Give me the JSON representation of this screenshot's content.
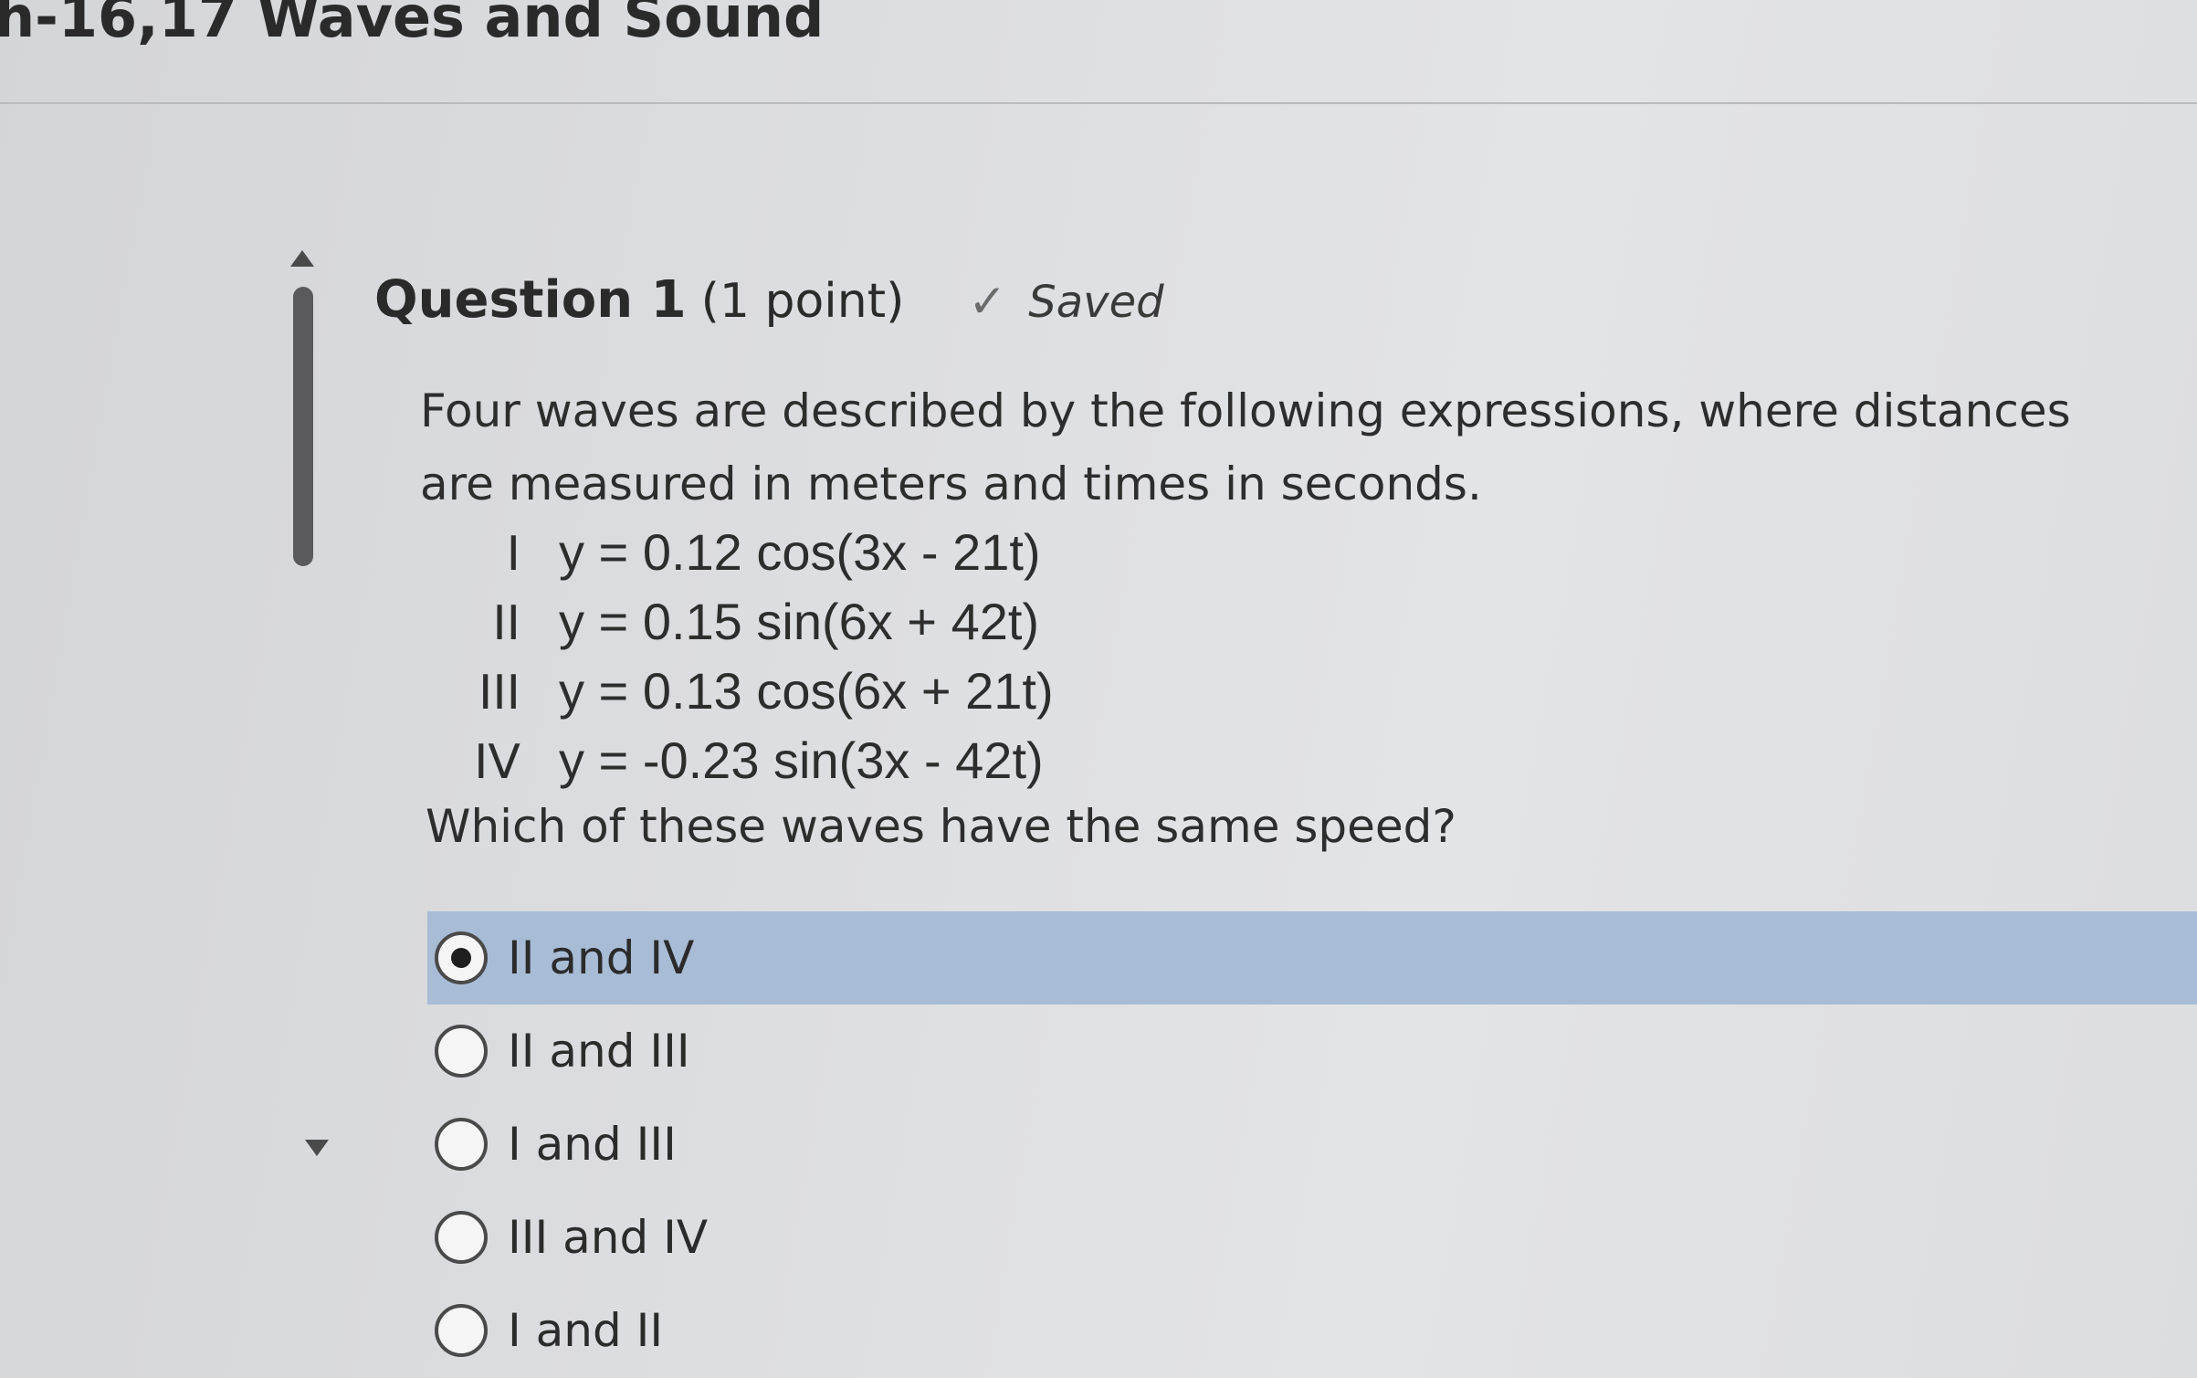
{
  "page": {
    "title": "h-16,17 Waves and Sound"
  },
  "question": {
    "label": "Question 1",
    "points": "(1 point)",
    "status": "Saved",
    "prompt": "Four waves are described by the following expressions, where distances are measured in meters and times in seconds.",
    "equations": [
      {
        "num": "I",
        "expr": "y = 0.12 cos(3x - 21t)"
      },
      {
        "num": "II",
        "expr": "y = 0.15 sin(6x + 42t)"
      },
      {
        "num": "III",
        "expr": "y = 0.13 cos(6x + 21t)"
      },
      {
        "num": "IV",
        "expr": "y = -0.23 sin(3x - 42t)"
      }
    ],
    "ask": "Which of these waves have the same speed?",
    "options": [
      {
        "label": "II and IV",
        "selected": true
      },
      {
        "label": "II and III",
        "selected": false
      },
      {
        "label": "I and III",
        "selected": false
      },
      {
        "label": "III and IV",
        "selected": false
      },
      {
        "label": "I and II",
        "selected": false
      }
    ]
  },
  "icons": {
    "saved": "check-icon",
    "scroll_up": "triangle-up-icon",
    "scroll_down": "triangle-down-icon"
  },
  "colors": {
    "selected_option_bg": "#a9bcd6",
    "background": "#dcdde0"
  }
}
